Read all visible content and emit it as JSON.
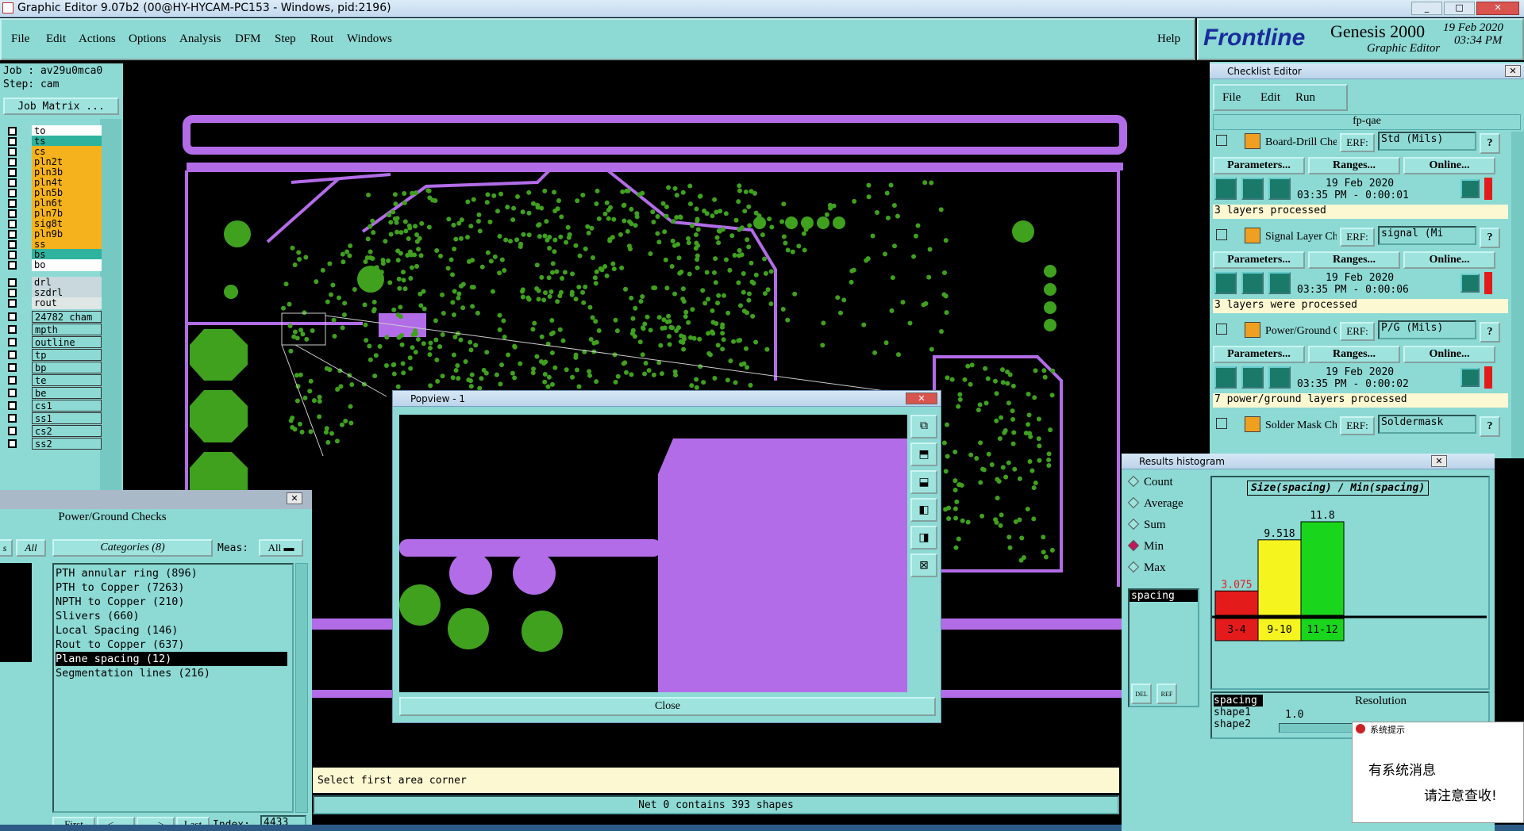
{
  "window_title": "Graphic Editor 9.07b2 (00@HY-HYCAM-PC153 - Windows, pid:2196)",
  "menu": [
    "File",
    "Edit",
    "Actions",
    "Options",
    "Analysis",
    "DFM",
    "Step",
    "Rout",
    "Windows"
  ],
  "help": "Help",
  "brand": {
    "logo": "Frontline",
    "product": "Genesis 2000",
    "subtitle": "Graphic Editor",
    "date": "19 Feb 2020",
    "time": "03:34 PM"
  },
  "job": {
    "job": "Job : av29u0mca0",
    "step": "Step: cam",
    "matrix_button": "Job Matrix ..."
  },
  "layers": [
    {
      "name": "to",
      "color": "#ffffff"
    },
    {
      "name": "ts",
      "color": "#2fb39f"
    },
    {
      "name": "cs",
      "color": "#f5b21c"
    },
    {
      "name": "pln2t",
      "color": "#f5b21c"
    },
    {
      "name": "pln3b",
      "color": "#f5b21c"
    },
    {
      "name": "pln4t",
      "color": "#f5b21c"
    },
    {
      "name": "pln5b",
      "color": "#f5b21c"
    },
    {
      "name": "pln6t",
      "color": "#f5b21c"
    },
    {
      "name": "pln7b",
      "color": "#f5b21c"
    },
    {
      "name": "sig8t",
      "color": "#f5b21c"
    },
    {
      "name": "pln9b",
      "color": "#f5b21c"
    },
    {
      "name": "ss",
      "color": "#f5b21c"
    },
    {
      "name": "bs",
      "color": "#2fb39f"
    },
    {
      "name": "bo",
      "color": "#ffffff"
    }
  ],
  "layers2": [
    {
      "name": "drl",
      "color": "#c8d8dc"
    },
    {
      "name": "szdrl",
      "color": "#c8d8dc"
    },
    {
      "name": "rout",
      "color": "#dfe6e6"
    }
  ],
  "layers3": [
    "24782_cham",
    "mpth",
    "outline",
    "tp",
    "bp",
    "te",
    "be",
    "cs1",
    "ss1",
    "cs2",
    "ss2"
  ],
  "checks": {
    "title": "Power/Ground Checks",
    "left_tab": "s",
    "all": "All",
    "categories": "Categories (8)",
    "meas_label": "Meas:",
    "meas_value": "All",
    "items": [
      "PTH annular ring (896)",
      "PTH to Copper (7263)",
      "NPTH to Copper (210)",
      "Slivers (660)",
      "Local Spacing (146)",
      "Rout to Copper (637)",
      "Plane spacing (12)",
      "Segmentation lines (216)"
    ],
    "selected_index": 6,
    "nav": {
      "first": "First",
      "prev": "<---",
      "next": "--->",
      "last": "Last",
      "index_label": "Index:",
      "index_value": "4433"
    }
  },
  "popview": {
    "title": "Popview - 1",
    "close": "Close"
  },
  "status": {
    "prompt": "Select first area corner",
    "net": "Net 0 contains 393 shapes"
  },
  "checklist": {
    "title": "Checklist Editor",
    "menu": [
      "File",
      "Edit",
      "Run"
    ],
    "name": "fp-qae",
    "rows": [
      {
        "name": "Board-Drill Che",
        "erf_label": "ERF:",
        "erf": "Std (Mils)",
        "date": "19 Feb 2020",
        "time": "03:35 PM - 0:00:01",
        "result": "3 layers processed"
      },
      {
        "name": "Signal Layer Ch",
        "erf_label": "ERF:",
        "erf": "signal (Mi",
        "date": "19 Feb 2020",
        "time": "03:35 PM - 0:00:06",
        "result": "3 layers were processed"
      },
      {
        "name": "Power/Ground C",
        "erf_label": "ERF:",
        "erf": "P/G (Mils)",
        "date": "19 Feb 2020",
        "time": "03:35 PM - 0:00:02",
        "result": "7 power/ground layers processed"
      },
      {
        "name": "Solder Mask Che",
        "erf_label": "ERF:",
        "erf": "Soldermask",
        "date": "",
        "time": "",
        "result": ""
      }
    ],
    "buttons": {
      "parameters": "Parameters...",
      "ranges": "Ranges...",
      "online": "Online..."
    }
  },
  "histogram": {
    "title": "Results histogram",
    "modes": [
      "Count",
      "Average",
      "Sum",
      "Min",
      "Max"
    ],
    "selected_mode": "Min",
    "list": [
      "spacing"
    ],
    "formula": "Size(spacing) / Min(spacing)",
    "bars": [
      {
        "label": "3-4",
        "value": 3.075,
        "label_value": "3.075",
        "color": "#e31b1b",
        "label_color": "#e31b1b"
      },
      {
        "label": "9-10",
        "value": 9.518,
        "label_value": "9.518",
        "color": "#f6f41f",
        "label_color": "#000000"
      },
      {
        "label": "11-12",
        "value": 11.8,
        "label_value": "11.8",
        "color": "#19d61d",
        "label_color": "#000000"
      }
    ],
    "bar_max": 11.8,
    "attributes": [
      "spacing",
      "shape1",
      "shape2"
    ],
    "resolution_label": "Resolution",
    "resolution_value": "1.0",
    "del": "DEL",
    "ref": "REF"
  },
  "notify": {
    "title": "系统提示",
    "line1": "有系统消息",
    "line2": "请注意查收!"
  }
}
